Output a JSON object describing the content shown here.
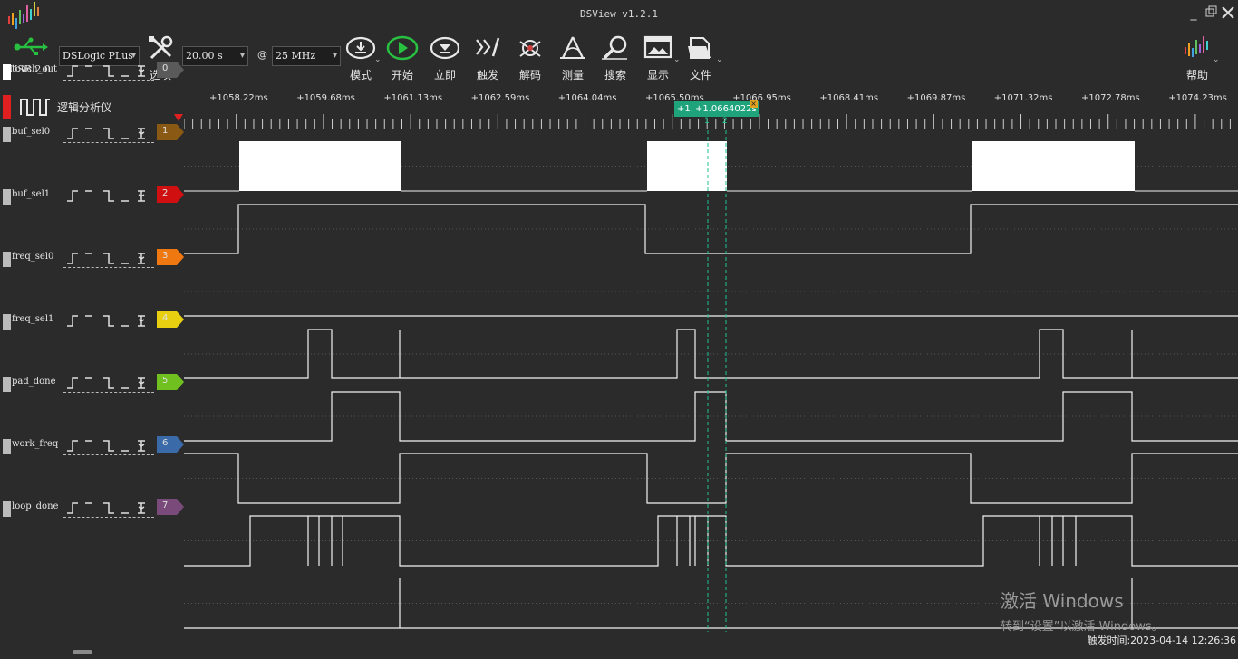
{
  "window": {
    "title": "DSView v1.2.1"
  },
  "toolbar": {
    "usb_label": "USB 2.0",
    "device": "DSLogic PLus",
    "options_label": "选项",
    "duration": "20.00 s",
    "at": "@",
    "samplerate": "25 MHz",
    "mode_label": "模式",
    "start_label": "开始",
    "instant_label": "立即",
    "trigger_label": "触发",
    "decode_label": "解码",
    "measure_label": "测量",
    "search_label": "搜索",
    "display_label": "显示",
    "file_label": "文件",
    "help_label": "帮助"
  },
  "panel": {
    "mode_title": "逻辑分析仪"
  },
  "ruler": {
    "ticks": [
      "+1058.22ms",
      "+1059.68ms",
      "+1061.13ms",
      "+1062.59ms",
      "+1064.04ms",
      "+1065.50ms",
      "+1066.95ms",
      "+1068.41ms",
      "+1069.87ms",
      "+1071.32ms",
      "+1072.78ms",
      "+1074.23ms"
    ]
  },
  "cursors": {
    "tag_left": "+1.",
    "tag_right": "+1.0664022s",
    "c1": "1",
    "c2": "2"
  },
  "channels": [
    {
      "name": "touch_out",
      "index": "0",
      "color": "#5a5a5a",
      "swatch": "#ffffff"
    },
    {
      "name": "buf_sel0",
      "index": "1",
      "color": "#8a5a14",
      "swatch": "#bbbbbb"
    },
    {
      "name": "buf_sel1",
      "index": "2",
      "color": "#d01010",
      "swatch": "#bbbbbb"
    },
    {
      "name": "freq_sel0",
      "index": "3",
      "color": "#f07810",
      "swatch": "#bbbbbb"
    },
    {
      "name": "freq_sel1",
      "index": "4",
      "color": "#e8d010",
      "swatch": "#bbbbbb"
    },
    {
      "name": "pad_done",
      "index": "5",
      "color": "#70c020",
      "swatch": "#bbbbbb"
    },
    {
      "name": "work_freq",
      "index": "6",
      "color": "#3a6aa8",
      "swatch": "#bbbbbb"
    },
    {
      "name": "loop_done",
      "index": "7",
      "color": "#7a4a7a",
      "swatch": "#bbbbbb"
    }
  ],
  "status": {
    "trigger_time": "触发时间:2023-04-14 12:26:36"
  },
  "watermark": {
    "line1": "激活 Windows",
    "line2": "转到“设置”以激活 Windows。"
  }
}
